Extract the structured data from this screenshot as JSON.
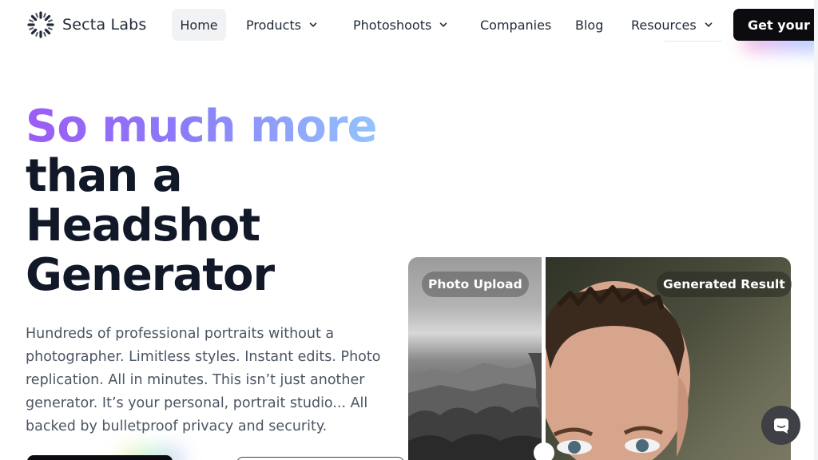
{
  "brand": {
    "name": "Secta Labs",
    "logo_icon": "sunburst-logo-icon"
  },
  "nav": {
    "items": [
      {
        "label": "Home",
        "active": true
      },
      {
        "label": "Products",
        "has_dropdown": true
      },
      {
        "label": "Photoshoots",
        "has_dropdown": true
      },
      {
        "label": "Companies"
      },
      {
        "label": "Blog"
      },
      {
        "label": "Resources",
        "has_dropdown": true
      }
    ],
    "cta_label": "Get your Ph"
  },
  "hero": {
    "headline_line1": "So much more",
    "headline_line2": "than a",
    "headline_line3": "Headshot",
    "headline_line4": "Generator",
    "description": "Hundreds of professional portraits without a photographer. Limitless styles. Instant edits. Photo replication. All in minutes. This isn’t just another generator. It’s your personal, portrait studio... All backed by bulletproof privacy and security."
  },
  "comparison": {
    "left_label": "Photo Upload",
    "right_label": "Generated Result"
  },
  "colors": {
    "headline_gradient": [
      "#9b5cf6",
      "#8b7cf8",
      "#93c5fd"
    ],
    "cta_background": "#0b0b10",
    "text_primary": "#111827",
    "text_secondary": "#4b5563"
  },
  "chat_icon": "chat-bubble-icon"
}
